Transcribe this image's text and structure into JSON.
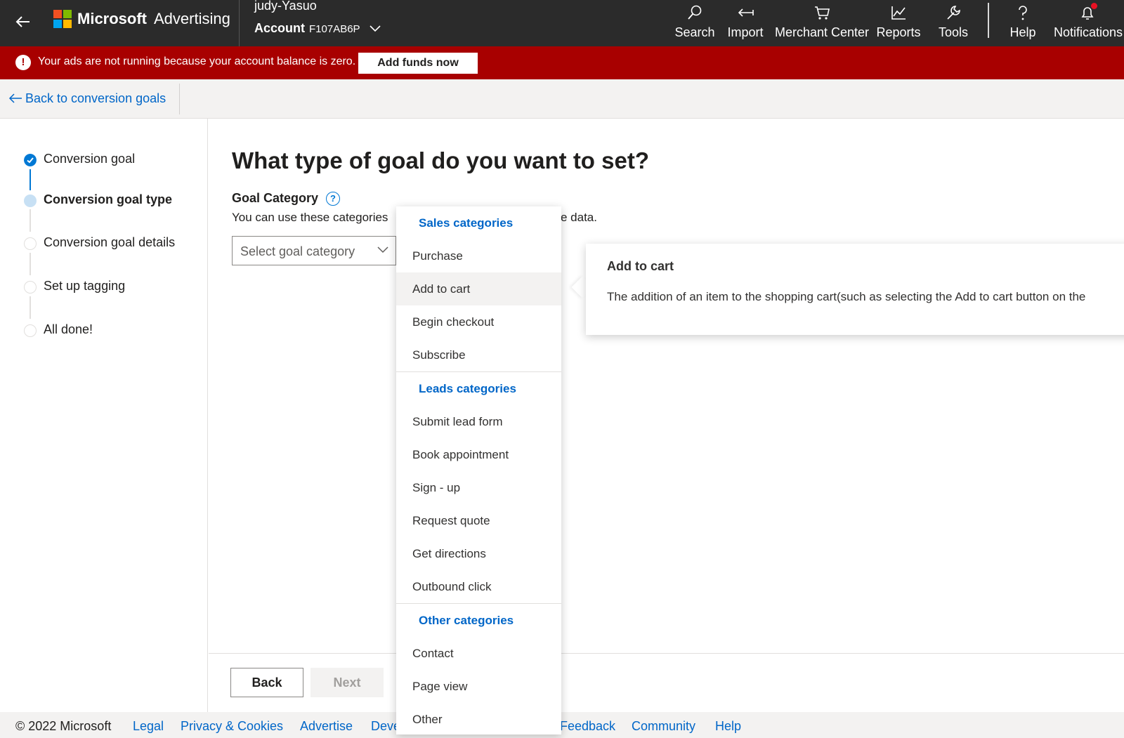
{
  "header": {
    "brand_main": "Microsoft",
    "brand_sub": "Advertising",
    "user": "judy-Yasuo",
    "account_label": "Account",
    "account_number": "F107AB6P",
    "nav": [
      {
        "label": "Search",
        "icon": "search-icon"
      },
      {
        "label": "Import",
        "icon": "import-icon"
      },
      {
        "label": "Merchant Center",
        "icon": "cart-icon"
      },
      {
        "label": "Reports",
        "icon": "chart-icon"
      },
      {
        "label": "Tools",
        "icon": "wrench-icon"
      },
      {
        "label": "Help",
        "icon": "question-icon"
      },
      {
        "label": "Notifications",
        "icon": "bell-icon"
      }
    ]
  },
  "alert": {
    "text": "Your ads are not running because your account balance is zero.",
    "button": "Add funds now",
    "color": "#a80000"
  },
  "breadcrumb": {
    "back_label": "Back to conversion goals"
  },
  "stepper": {
    "steps": [
      {
        "label": "Conversion goal",
        "state": "done"
      },
      {
        "label": "Conversion goal type",
        "state": "current"
      },
      {
        "label": "Conversion goal details",
        "state": "pending"
      },
      {
        "label": "Set up tagging",
        "state": "pending"
      },
      {
        "label": "All done!",
        "state": "pending"
      }
    ]
  },
  "main": {
    "heading": "What type of goal do you want to set?",
    "category_label": "Goal Category",
    "description_start": "You can use these categories",
    "description_end": "e data.",
    "select_placeholder": "Select goal category"
  },
  "dropdown": {
    "groups": [
      {
        "header": "Sales categories",
        "items": [
          "Purchase",
          "Add to cart",
          "Begin checkout",
          "Subscribe"
        ]
      },
      {
        "header": "Leads categories",
        "items": [
          "Submit lead form",
          "Book appointment",
          "Sign - up",
          "Request quote",
          "Get directions",
          "Outbound click"
        ]
      },
      {
        "header": "Other categories",
        "items": [
          "Contact",
          "Page view",
          "Other"
        ]
      }
    ],
    "highlighted": "Add to cart"
  },
  "tooltip": {
    "title": "Add to cart",
    "description": "The addition of an item to the shopping cart(such as selecting the Add to cart button on the"
  },
  "actions": {
    "back": "Back",
    "next": "Next"
  },
  "footer": {
    "copyright": "© 2022 Microsoft",
    "links": [
      "Legal",
      "Privacy & Cookies",
      "Advertise",
      "Deve",
      "Feedback",
      "Community",
      "Help"
    ]
  },
  "colors": {
    "accent": "#0078d4",
    "link": "#0066c8",
    "topbar": "#2b2b2b"
  }
}
